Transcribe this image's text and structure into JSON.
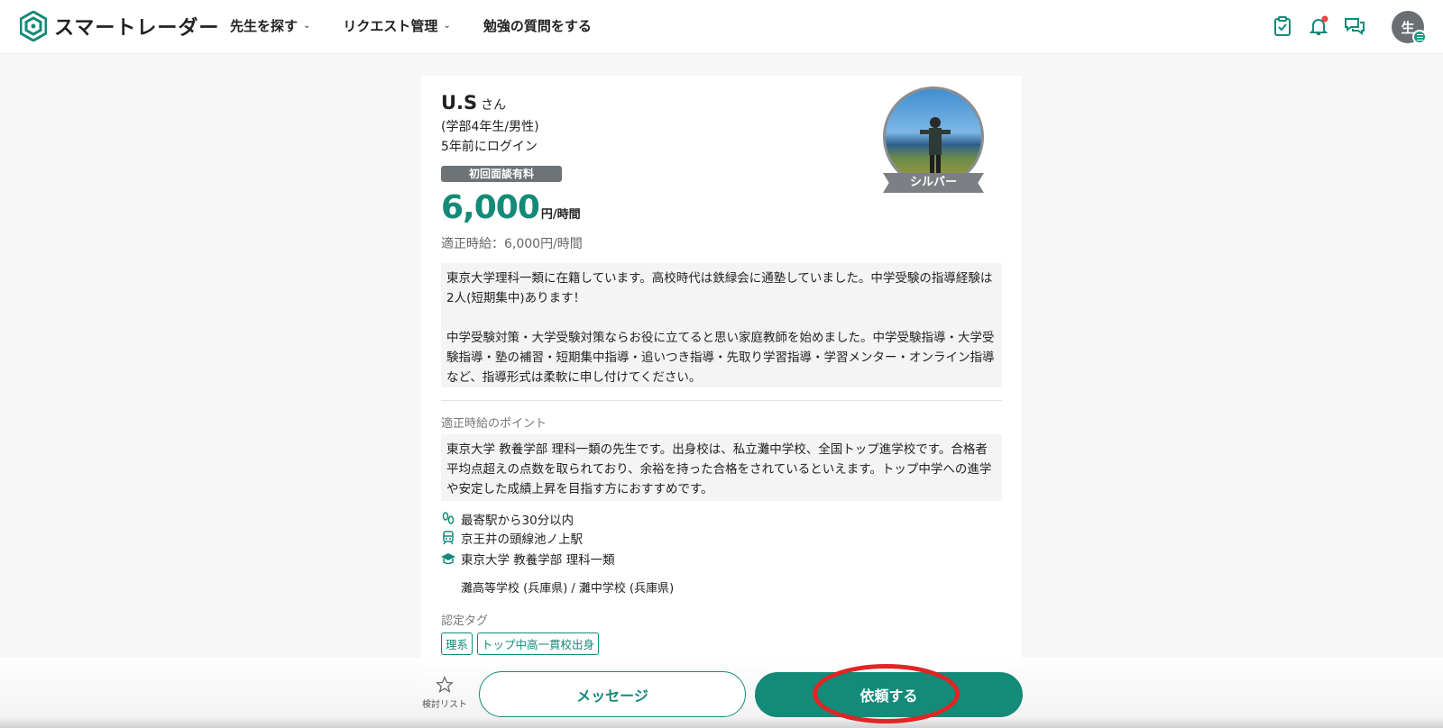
{
  "header": {
    "logo_text": "スマートレーダー",
    "nav": [
      {
        "label": "先生を探す",
        "dropdown": true
      },
      {
        "label": "リクエスト管理",
        "dropdown": true
      },
      {
        "label": "勉強の質問をする",
        "dropdown": false
      }
    ],
    "icons": [
      "clipboard-check-icon",
      "bell-icon",
      "chat-icon"
    ],
    "user_avatar_initial": "生",
    "notification_dot_color": "#e8453c"
  },
  "profile": {
    "name": "U.S",
    "honorific": "さん",
    "grade_gender": "(学部4年生/男性)",
    "last_login": "5年前にログイン",
    "interview_badge": "初回面談有料",
    "price": "6,000",
    "price_unit": "円/時間",
    "fair_wage": "適正時給：6,000円/時間",
    "rank": "シルバー",
    "description": "東京大学理科一類に在籍しています。高校時代は鉄緑会に通塾していました。中学受験の指導経験は2人(短期集中)あります！\n\n中学受験対策・大学受験対策ならお役に立てると思い家庭教師を始めました。中学受験指導・大学受験指導・塾の補習・短期集中指導・追いつき指導・先取り学習指導・学習メンター・オンライン指導など、指導形式は柔軟に申し付けてください。",
    "fair_wage_point_label": "適正時給のポイント",
    "fair_wage_point": "東京大学 教養学部 理科一類の先生です。出身校は、私立灘中学校、全国トップ進学校です。合格者平均点超えの点数を取られており、余裕を持った合格をされているといえます。トップ中学への進学や安定した成績上昇を目指す方におすすめです。",
    "access": "最寄駅から30分以内",
    "station": "京王井の頭線池ノ上駅",
    "university": "東京大学 教養学部 理科一類",
    "schools": "灘高等学校 (兵庫県) / 灘中学校 (兵庫県)",
    "tag_label": "認定タグ",
    "tags": [
      "理系",
      "トップ中高一貫校出身"
    ]
  },
  "actions": {
    "wishlist_label": "検討リスト",
    "message_label": "メッセージ",
    "request_label": "依頼する"
  },
  "colors": {
    "accent": "#148a78",
    "highlight_ring": "#e12424"
  }
}
